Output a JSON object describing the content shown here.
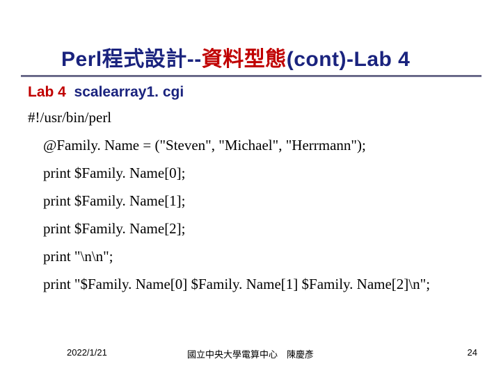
{
  "title": {
    "part1": "Perl程式設計",
    "dash": "--",
    "part2": "資料型態",
    "part3": "(cont)-Lab 4"
  },
  "lab_label": {
    "red": "Lab 4",
    "blue": "scalearray1. cgi"
  },
  "code": {
    "l0": "#!/usr/bin/perl",
    "l1": "@Family. Name = (\"Steven\", \"Michael\", \"Herrmann\");",
    "l2": "print $Family. Name[0];",
    "l3": "print $Family. Name[1];",
    "l4": "print $Family. Name[2];",
    "l5": "print \"\\n\\n\";",
    "l6": "print \"$Family. Name[0] $Family. Name[1]  $Family. Name[2]\\n\";"
  },
  "footer": {
    "date": "2022/1/21",
    "center": "國立中央大學電算中心　陳慶彥",
    "page": "24"
  }
}
